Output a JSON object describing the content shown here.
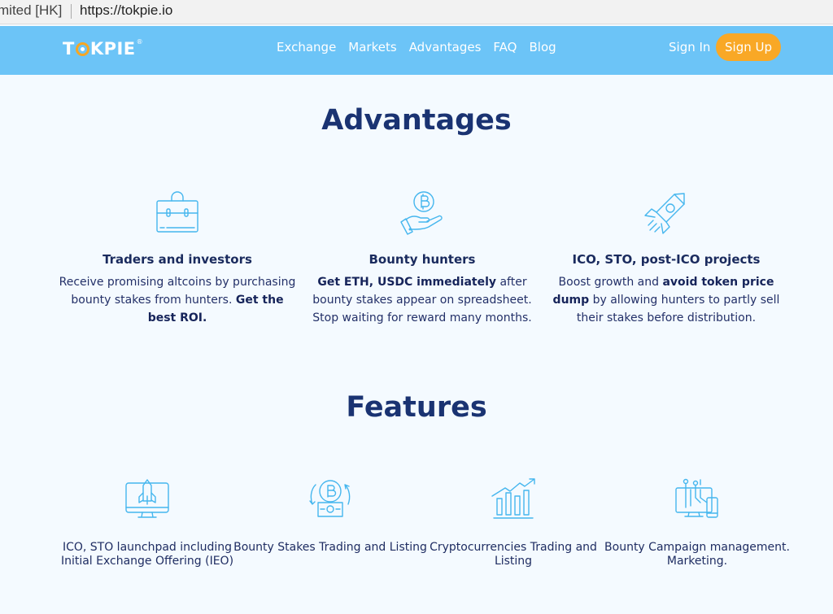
{
  "browser": {
    "org_label": "mited [HK]",
    "url": "https://tokpie.io"
  },
  "header": {
    "logo": {
      "t": "T",
      "rest": "KPIE",
      "reg": "®"
    },
    "nav": [
      {
        "label": "Exchange",
        "icon": null
      },
      {
        "label": "Markets",
        "icon": null
      },
      {
        "label": "Advantages",
        "icon": null
      },
      {
        "label": "FAQ",
        "icon": null
      },
      {
        "label": "Blog",
        "icon": null
      }
    ],
    "sign_in": "Sign In",
    "sign_up": "Sign Up",
    "colors": {
      "bar": "#6cc4f7",
      "accent": "#f9a826"
    }
  },
  "advantages": {
    "title": "Advantages",
    "items": [
      {
        "icon": "briefcase-icon",
        "heading": "Traders and investors",
        "text_pre": "Receive promising altcoins by purchasing bounty stakes from hunters. ",
        "text_bold": "Get the best ROI.",
        "text_post": ""
      },
      {
        "icon": "bitcoin-hand-icon",
        "heading": "Bounty hunters",
        "text_pre": "",
        "text_bold": "Get ETH, USDC immediately",
        "text_post": " after bounty stakes appear on spreadsheet. Stop waiting for reward many months."
      },
      {
        "icon": "rocket-icon",
        "heading": "ICO, STO, post-ICO projects",
        "text_pre": "Boost growth and ",
        "text_bold": "avoid token price dump",
        "text_post": " by allowing hunters to partly sell their stakes before distribution."
      }
    ]
  },
  "features": {
    "title": "Features",
    "items": [
      {
        "icon": "monitor-rocket-icon",
        "text": "ICO, STO launchpad including Initial Exchange Offering (IEO)"
      },
      {
        "icon": "bitcoin-exchange-icon",
        "text": "Bounty Stakes Trading and Listing"
      },
      {
        "icon": "growth-chart-icon",
        "text": "Cryptocurrencies Trading and Listing"
      },
      {
        "icon": "devices-circuit-icon",
        "text": "Bounty Campaign management. Marketing."
      }
    ]
  }
}
